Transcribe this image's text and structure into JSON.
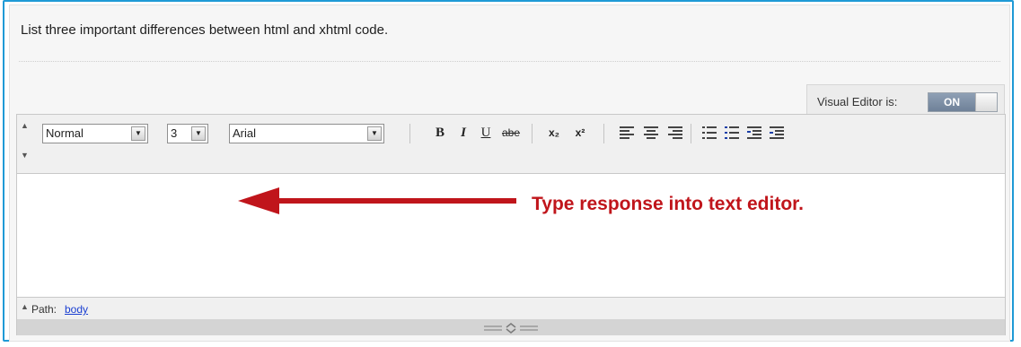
{
  "question": "List three important differences between html and xhtml code.",
  "visual_editor": {
    "label": "Visual Editor is:",
    "state": "ON"
  },
  "toolbar": {
    "format_select": "Normal",
    "size_select": "3",
    "font_select": "Arial",
    "bold": "B",
    "italic": "I",
    "underline": "U",
    "strike": "abe",
    "subscript": "x₂",
    "superscript": "x²"
  },
  "annotation": {
    "text": "Type response into text editor.",
    "color": "#c0151b"
  },
  "status": {
    "path_label": "Path:",
    "path_value": "body"
  },
  "colors": {
    "frame": "#1f9ad6",
    "toggle_on": "#7689a0",
    "link": "#1a3fd1"
  }
}
